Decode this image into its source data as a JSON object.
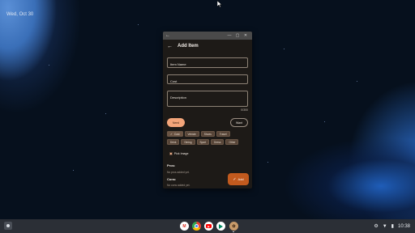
{
  "desktop": {
    "date": "Wed, Oct 30"
  },
  "window": {
    "titlebar": {
      "back_glyph": "←",
      "minimize_glyph": "—",
      "maximize_glyph": "▢",
      "close_glyph": "✕"
    },
    "appbar": {
      "back_glyph": "←",
      "title": "Add Item"
    },
    "form": {
      "item_name_label": "Item Name",
      "cost_label": "Cost",
      "description_label": "Description",
      "description_counter": "0/300"
    },
    "toggle": {
      "need_label": "Need",
      "want_label": "Want",
      "selected": "Need"
    },
    "categories": {
      "row1": [
        "Cost",
        "Vehicle",
        "Shoes",
        "Travel"
      ],
      "row2": [
        "Drink",
        "Dining",
        "Sport",
        "Dress",
        "Other"
      ],
      "selected": "Cost",
      "check_glyph": "✓"
    },
    "pick_image": {
      "icon": "camera-icon",
      "label": "Pick Image"
    },
    "pros": {
      "title": "Pros:",
      "empty": "No pros added yet."
    },
    "cons": {
      "title": "Cons:",
      "empty": "No cons added yet."
    },
    "fab": {
      "check_glyph": "✓",
      "label": "Add"
    }
  },
  "shelf": {
    "apps": [
      {
        "name": "gmail",
        "glyph": "M"
      },
      {
        "name": "chrome",
        "glyph": ""
      },
      {
        "name": "youtube",
        "glyph": "▶"
      },
      {
        "name": "play-store",
        "glyph": ""
      },
      {
        "name": "custom-app",
        "glyph": "✿"
      }
    ],
    "tray": {
      "settings_glyph": "⚙",
      "wifi_glyph": "▼",
      "battery_glyph": "▮",
      "time": "10:38"
    }
  },
  "colors": {
    "accent": "#c25a1e",
    "need_selected": "#f3a57a",
    "chip": "#574538",
    "window_bg": "#1d1a17",
    "shelf_bg": "#2b2f36"
  }
}
